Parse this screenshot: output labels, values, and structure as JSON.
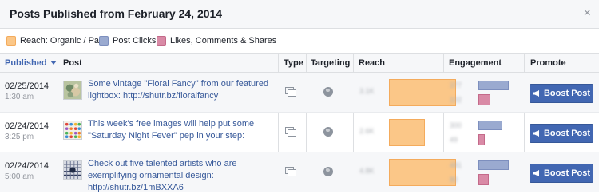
{
  "dialog": {
    "title": "Posts Published from February 24, 2014",
    "close_label": "×"
  },
  "legend": [
    {
      "label": "Reach: Organic / Paid",
      "color": "#fbc788"
    },
    {
      "label": "Post Clicks",
      "color": "#9aaad0"
    },
    {
      "label": "Likes, Comments & Shares",
      "color": "#d98aa6"
    }
  ],
  "columns": {
    "published": "Published",
    "post": "Post",
    "type": "Type",
    "targeting": "Targeting",
    "reach": "Reach",
    "engagement": "Engagement",
    "promote": "Promote"
  },
  "posts": [
    {
      "date": "02/25/2014",
      "time": "1:30 am",
      "text": "Some vintage \"Floral Fancy\" from our featured lightbox: http://shutr.bz/floralfancy",
      "reach_blur": "3.1K",
      "clicks_blur": "377",
      "likes_blur": "102",
      "reach_fraction": 1.0,
      "clicks_fraction": 1.0,
      "likes_fraction": 0.4,
      "boost_label": "Boost Post"
    },
    {
      "date": "02/24/2014",
      "time": "3:25 pm",
      "text": "This week's free images will help put some \"Saturday Night Fever\" pep in your step:",
      "reach_blur": "2.6K",
      "clicks_blur": "300",
      "likes_blur": "49",
      "reach_fraction": 0.75,
      "clicks_fraction": 0.8,
      "likes_fraction": 0.2,
      "boost_label": "Boost Post"
    },
    {
      "date": "02/24/2014",
      "time": "5:00 am",
      "text": "Check out five talented artists who are exemplifying ornamental design: http://shutr.bz/1mBXXA6",
      "reach_blur": "4.8K",
      "clicks_blur": "481",
      "likes_blur": "80",
      "reach_fraction": 1.0,
      "clicks_fraction": 1.0,
      "likes_fraction": 0.35,
      "boost_label": "Boost Post"
    }
  ]
}
